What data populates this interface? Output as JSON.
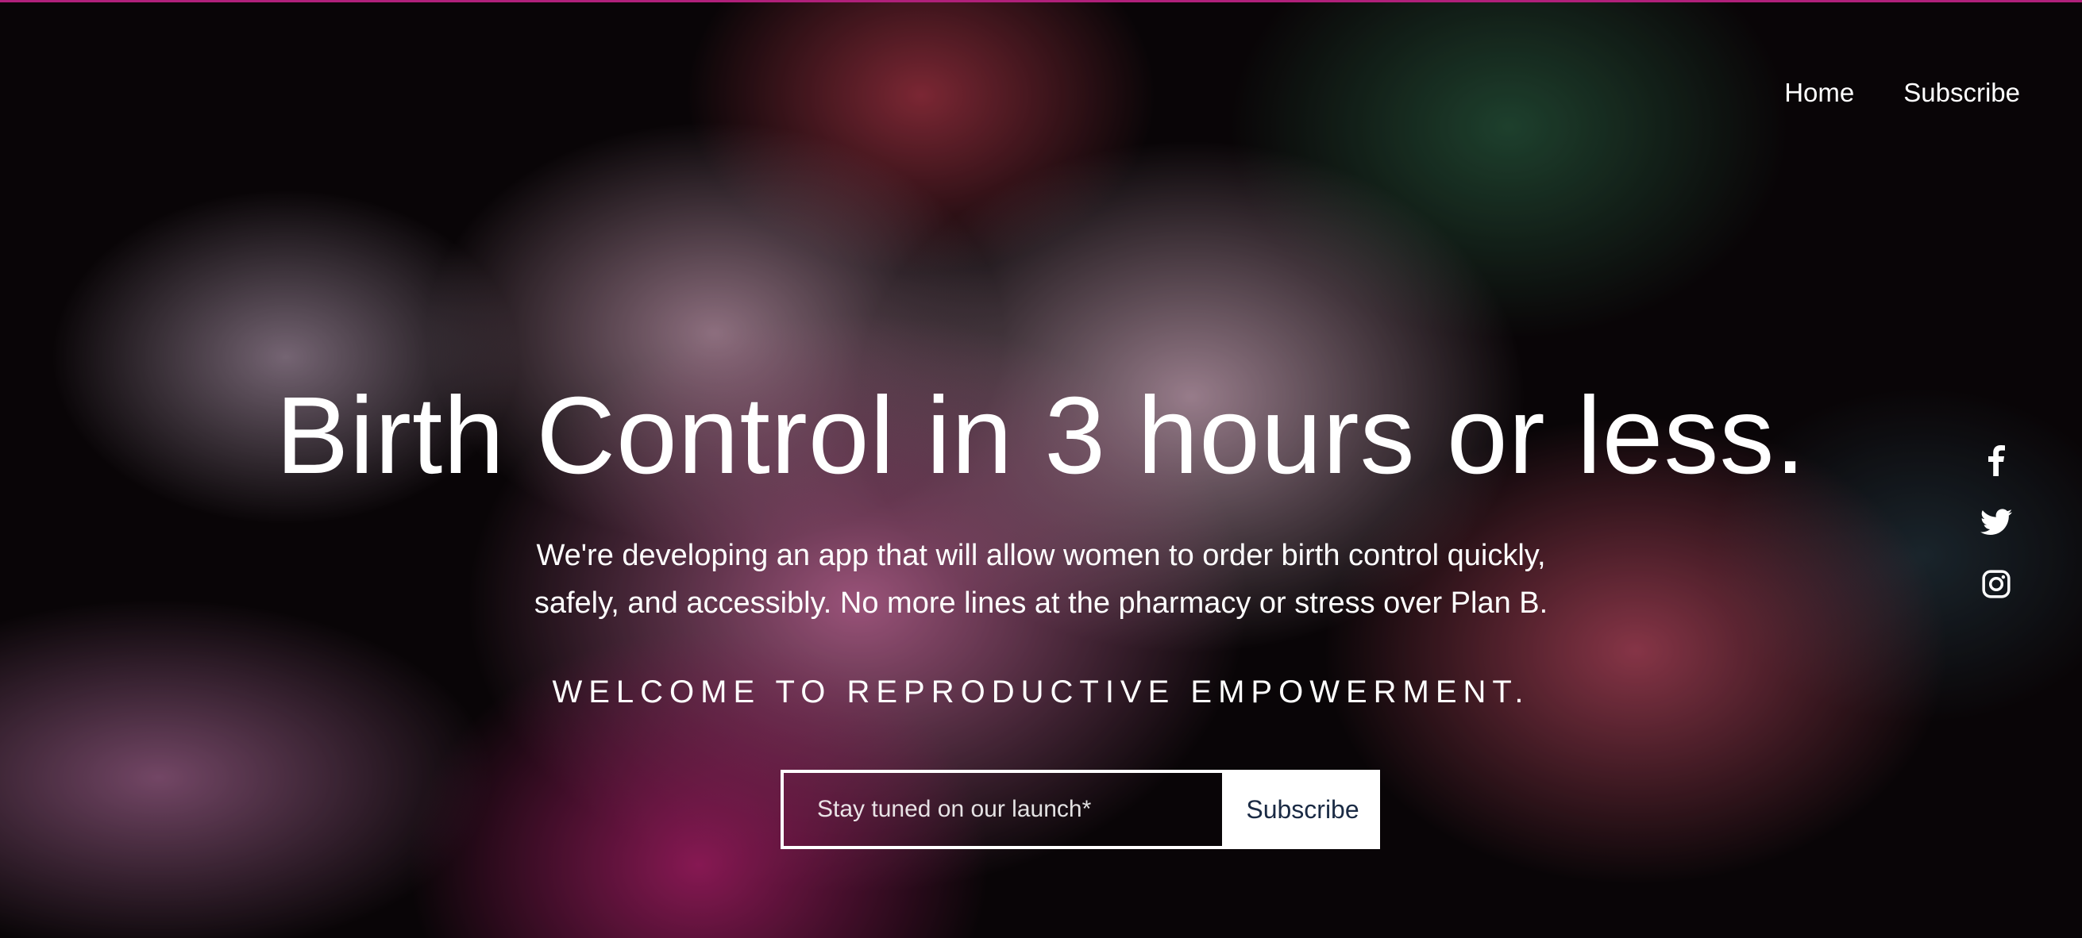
{
  "nav": {
    "items": [
      {
        "label": "Home"
      },
      {
        "label": "Subscribe"
      }
    ]
  },
  "hero": {
    "headline": "Birth Control in 3 hours or less.",
    "description_line1": "We're developing an app that will allow women to order birth control quickly,",
    "description_line2": "safely, and accessibly. No more lines at the pharmacy or stress over Plan B.",
    "tagline": "WELCOME TO REPRODUCTIVE EMPOWERMENT."
  },
  "signup": {
    "placeholder": "Stay tuned on our launch*",
    "value": "",
    "button_label": "Subscribe"
  },
  "social": [
    {
      "icon": "facebook-icon"
    },
    {
      "icon": "twitter-icon"
    },
    {
      "icon": "instagram-icon"
    }
  ],
  "colors": {
    "accent_line": "#b0207a",
    "button_text": "#1a2a44",
    "text": "#ffffff"
  }
}
